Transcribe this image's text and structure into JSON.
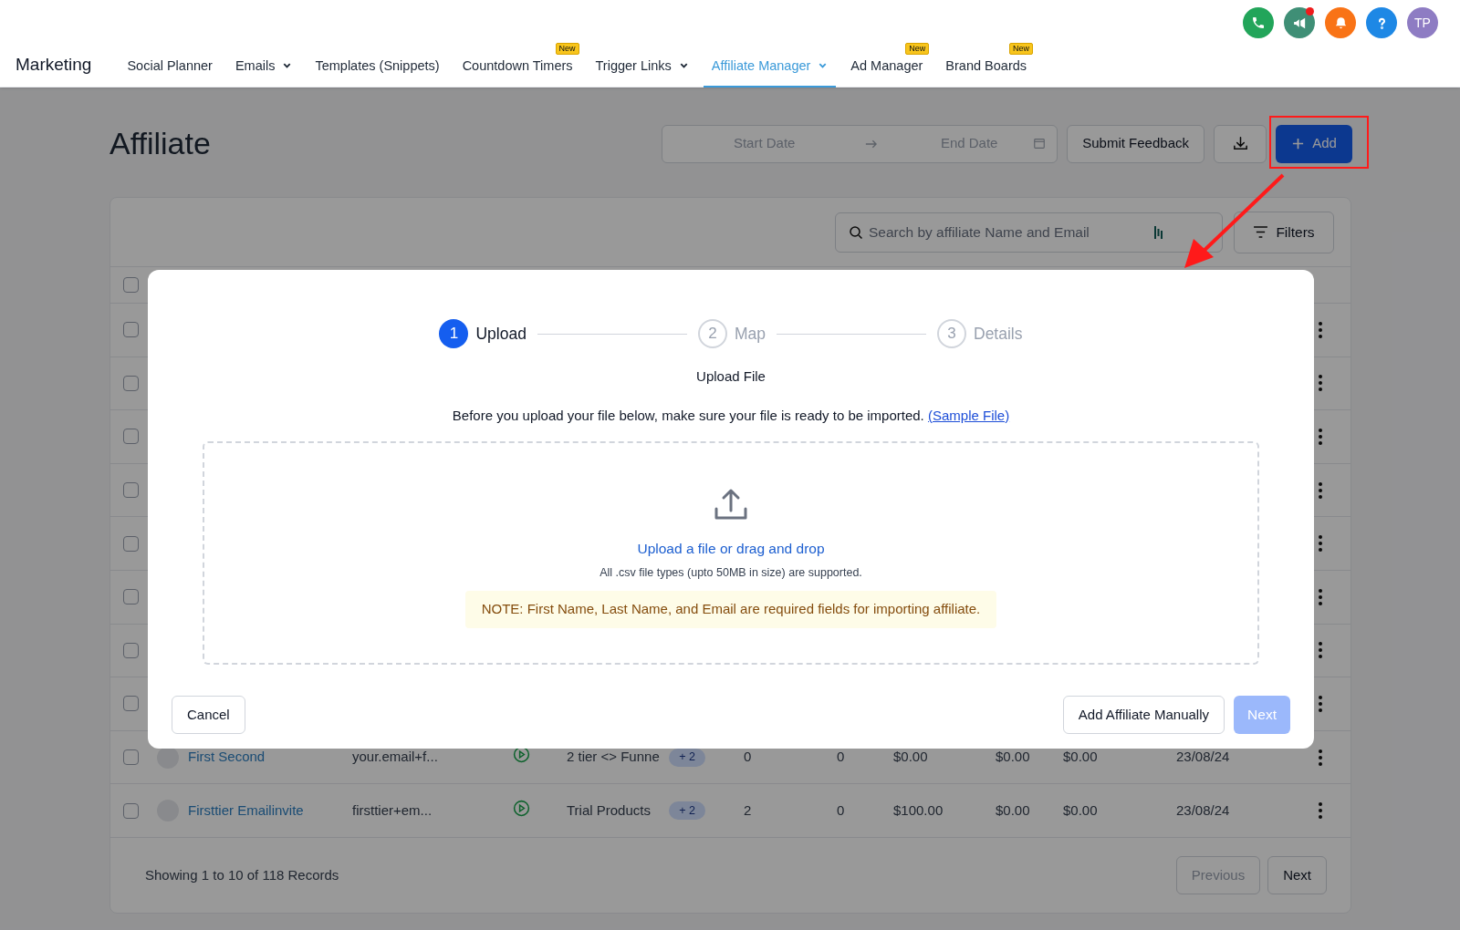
{
  "app_title": "Marketing",
  "top_icons": [
    {
      "kind": "phone",
      "color": "#22a55a",
      "dot": false
    },
    {
      "kind": "megaphone",
      "color": "#3f8f76",
      "dot": true
    },
    {
      "kind": "bell",
      "color": "#f97316",
      "dot": false
    },
    {
      "kind": "help",
      "color": "#1e88e5",
      "dot": false
    }
  ],
  "avatar": {
    "initials": "TP"
  },
  "nav": [
    {
      "label": "Social Planner",
      "selected": false,
      "dropdown": false
    },
    {
      "label": "Emails",
      "selected": false,
      "dropdown": true
    },
    {
      "label": "Templates (Snippets)",
      "selected": false,
      "dropdown": false
    },
    {
      "label": "Countdown Timers",
      "selected": false,
      "dropdown": false,
      "badge": "New"
    },
    {
      "label": "Trigger Links",
      "selected": false,
      "dropdown": true
    },
    {
      "label": "Affiliate Manager",
      "selected": true,
      "dropdown": true
    },
    {
      "label": "Ad Manager",
      "selected": false,
      "dropdown": false,
      "badge": "New"
    },
    {
      "label": "Brand Boards",
      "selected": false,
      "dropdown": false,
      "badge": "New"
    }
  ],
  "page_title": "Affiliate",
  "date_range": {
    "start_placeholder": "Start Date",
    "end_placeholder": "End Date"
  },
  "buttons": {
    "feedback": "Submit Feedback",
    "add": "Add"
  },
  "search": {
    "placeholder": "Search by affiliate Name and Email"
  },
  "filters_button": "Filters",
  "table": {
    "header_checked": false,
    "rows": [
      {
        "checked": false
      },
      {
        "checked": false
      },
      {
        "checked": false
      },
      {
        "checked": false
      },
      {
        "checked": false
      },
      {
        "checked": false
      },
      {
        "checked": false
      },
      {
        "checked": false
      },
      {
        "checked": false,
        "name": "First Second",
        "email": "your.email+f...",
        "campaign": "2 tier <> Funne",
        "more": "+ 2",
        "column_6": "0",
        "column_7": "0",
        "column_8": "$0.00",
        "column_9": "$0.00",
        "column_10": "$0.00",
        "date": "23/08/24"
      },
      {
        "checked": false,
        "name": "Firsttier Emailinvite",
        "email": "firsttier+em...",
        "campaign": "Trial Products",
        "more": "+ 2",
        "column_6": "2",
        "column_7": "0",
        "column_8": "$100.00",
        "column_9": "$0.00",
        "column_10": "$0.00",
        "date": "23/08/24"
      }
    ]
  },
  "pagination": {
    "summary": "Showing 1 to 10 of 118 Records",
    "previous": "Previous",
    "next": "Next"
  },
  "modal": {
    "steps": [
      {
        "number": "1",
        "label": "Upload",
        "selected": true
      },
      {
        "number": "2",
        "label": "Map",
        "selected": false
      },
      {
        "number": "3",
        "label": "Details",
        "selected": false
      }
    ],
    "heading": "Upload File",
    "intro": "Before you upload your file below, make sure your file is ready to be imported.",
    "sample_link": "(Sample File)",
    "upload_link": "Upload a file or drag and drop",
    "hint": "All .csv file types (upto 50MB in size) are supported.",
    "note": "NOTE: First Name, Last Name, and Email are required fields for importing affiliate.",
    "cancel": "Cancel",
    "manual": "Add Affiliate Manually",
    "next": "Next",
    "next_disabled": true
  }
}
